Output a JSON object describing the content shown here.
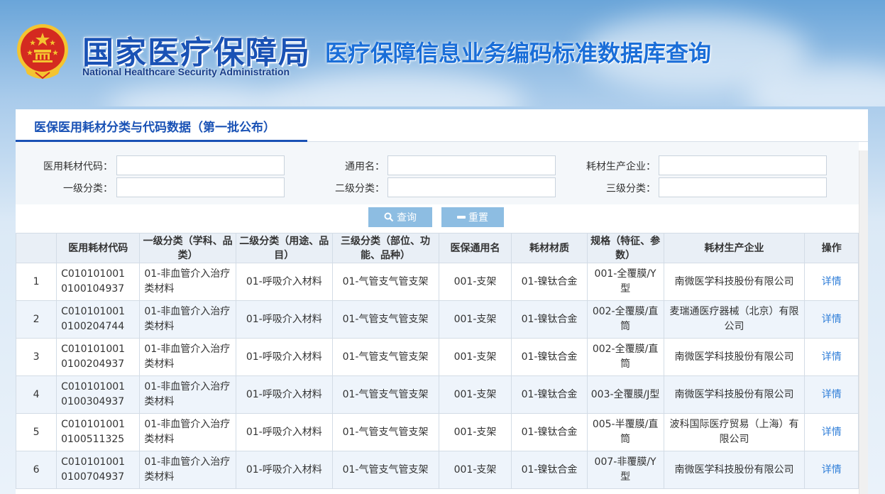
{
  "header": {
    "title_cn": "国家医疗保障局",
    "subtitle": "医疗保障信息业务编码标准数据库查询",
    "title_en": "National Healthcare Security Administration",
    "emblem_icon": "national-emblem-icon"
  },
  "tab": {
    "label": "医保医用耗材分类与代码数据（第一批公布）"
  },
  "search": {
    "code_label": "医用耗材代码：",
    "code_value": "",
    "generic_label": "通用名：",
    "generic_value": "",
    "maker_label": "耗材生产企业：",
    "maker_value": "",
    "level1_label": "一级分类：",
    "level1_value": "",
    "level2_label": "二级分类：",
    "level2_value": "",
    "level3_label": "三级分类：",
    "level3_value": ""
  },
  "buttons": {
    "query_label": "查询",
    "query_icon": "search-icon",
    "reset_label": "重置",
    "reset_icon": "minus-icon"
  },
  "table": {
    "headers": [
      "",
      "医用耗材代码",
      "一级分类（学科、品类）",
      "二级分类（用途、品目）",
      "三级分类（部位、功能、品种）",
      "医保通用名",
      "耗材材质",
      "规格（特征、参数）",
      "耗材生产企业",
      "操作"
    ],
    "rows": [
      {
        "no": "1",
        "code": "C010101001 0100104937",
        "l1": "01-非血管介入治疗类材料",
        "l2": "01-呼吸介入材料",
        "l3": "01-气管支气管支架",
        "generic": "001-支架",
        "material": "01-镍钛合金",
        "spec": "001-全覆膜/Y型",
        "maker": "南微医学科技股份有限公司",
        "action": "详情"
      },
      {
        "no": "2",
        "code": "C010101001 0100204744",
        "l1": "01-非血管介入治疗类材料",
        "l2": "01-呼吸介入材料",
        "l3": "01-气管支气管支架",
        "generic": "001-支架",
        "material": "01-镍钛合金",
        "spec": "002-全覆膜/直筒",
        "maker": "麦瑞通医疗器械（北京）有限公司",
        "action": "详情"
      },
      {
        "no": "3",
        "code": "C010101001 0100204937",
        "l1": "01-非血管介入治疗类材料",
        "l2": "01-呼吸介入材料",
        "l3": "01-气管支气管支架",
        "generic": "001-支架",
        "material": "01-镍钛合金",
        "spec": "002-全覆膜/直筒",
        "maker": "南微医学科技股份有限公司",
        "action": "详情"
      },
      {
        "no": "4",
        "code": "C010101001 0100304937",
        "l1": "01-非血管介入治疗类材料",
        "l2": "01-呼吸介入材料",
        "l3": "01-气管支气管支架",
        "generic": "001-支架",
        "material": "01-镍钛合金",
        "spec": "003-全覆膜/J型",
        "maker": "南微医学科技股份有限公司",
        "action": "详情"
      },
      {
        "no": "5",
        "code": "C010101001 0100511325",
        "l1": "01-非血管介入治疗类材料",
        "l2": "01-呼吸介入材料",
        "l3": "01-气管支气管支架",
        "generic": "001-支架",
        "material": "01-镍钛合金",
        "spec": "005-半覆膜/直筒",
        "maker": "波科国际医疗贸易（上海）有限公司",
        "action": "详情"
      },
      {
        "no": "6",
        "code": "C010101001 0100704937",
        "l1": "01-非血管介入治疗类材料",
        "l2": "01-呼吸介入材料",
        "l3": "01-气管支气管支架",
        "generic": "001-支架",
        "material": "01-镍钛合金",
        "spec": "007-非覆膜/Y型",
        "maker": "南微医学科技股份有限公司",
        "action": "详情"
      }
    ]
  },
  "colors": {
    "brand_blue": "#1a52b5",
    "button_blue": "#8dbde2",
    "link_blue": "#2f7ed8",
    "emblem_red": "#d42a20",
    "emblem_gold": "#f4c430"
  }
}
